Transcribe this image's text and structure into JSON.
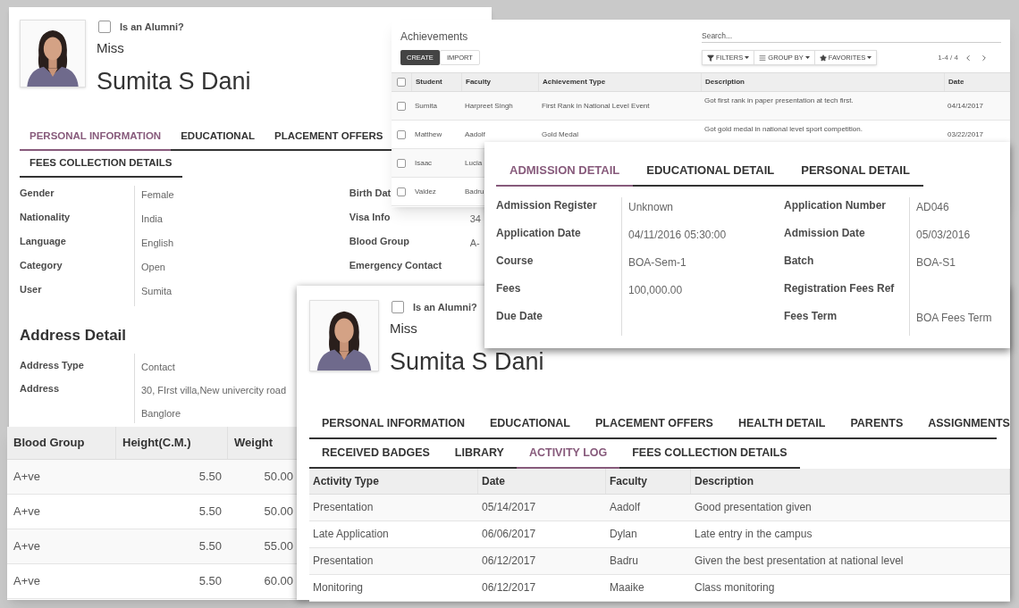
{
  "profile_back": {
    "alumni": {
      "label": "Is an Alumni?",
      "checked": false
    },
    "title": "Miss",
    "name": "Sumita S Dani",
    "tab_rows": [
      [
        {
          "label": "PERSONAL INFORMATION",
          "selected": true
        },
        {
          "label": "EDUCATIONAL",
          "selected": false
        },
        {
          "label": "PLACEMENT OFFERS",
          "selected": false
        }
      ],
      [
        {
          "label": "FEES COLLECTION DETAILS",
          "selected": false
        }
      ]
    ],
    "fields_left": [
      {
        "label": "Gender",
        "value": "Female"
      },
      {
        "label": "Nationality",
        "value": "India"
      },
      {
        "label": "Language",
        "value": "English"
      },
      {
        "label": "Category",
        "value": "Open"
      },
      {
        "label": "User",
        "value": "Sumita"
      }
    ],
    "fields_right": [
      {
        "label": "Birth Dat"
      },
      {
        "label": "Visa Info",
        "value": "34"
      },
      {
        "label": "Blood Group",
        "value": "A-"
      },
      {
        "label": "Emergency Contact"
      }
    ],
    "address_heading": "Address Detail",
    "address_fields": [
      {
        "label": "Address Type",
        "values": [
          "Contact"
        ]
      },
      {
        "label": "Address",
        "values": [
          "30, FIrst villa,New univercity road",
          "Banglore"
        ]
      }
    ]
  },
  "achievements": {
    "title": "Achievements",
    "search_placeholder": "Search...",
    "buttons": [
      {
        "label": "CREATE",
        "kind": "primary"
      },
      {
        "label": "IMPORT",
        "kind": "secondary"
      }
    ],
    "filters": [
      {
        "label": "FILTERS",
        "kind": "filter"
      },
      {
        "label": "GROUP BY",
        "kind": "group"
      },
      {
        "label": "FAVORITES",
        "kind": "favorite"
      }
    ],
    "pager": "1-4 / 4",
    "select_all_checked": false,
    "columns": [
      "Student",
      "Faculty",
      "Achievement Type",
      "Description",
      "Date"
    ],
    "rows": [
      {
        "checked": false,
        "cells": [
          "Sumita",
          "Harpreet Singh",
          "First Rank in National Level Event",
          "Got first rank in paper presentation at tech first.",
          "04/14/2017"
        ]
      },
      {
        "checked": false,
        "cells": [
          "Matthew",
          "Aadolf",
          "Gold Medal",
          "Got gold medal in national level sport competition.",
          "03/22/2017"
        ]
      },
      {
        "checked": false,
        "cells": [
          "Isaac",
          "Lucia"
        ]
      },
      {
        "checked": false,
        "cells": [
          "Valdez",
          "Badru"
        ]
      }
    ]
  },
  "admission": {
    "tabs": [
      {
        "label": "ADMISSION DETAIL",
        "selected": true
      },
      {
        "label": "EDUCATIONAL DETAIL",
        "selected": false
      },
      {
        "label": "PERSONAL DETAIL",
        "selected": false
      }
    ],
    "fields_left": [
      {
        "label": "Admission Register",
        "value": "Unknown"
      },
      {
        "label": "Application Date",
        "value": "04/11/2016 05:30:00"
      },
      {
        "label": "Course",
        "value": "BOA-Sem-1"
      },
      {
        "label": "Fees",
        "value": "100,000.00"
      },
      {
        "label": "Due Date"
      }
    ],
    "fields_right": [
      {
        "label": "Application Number",
        "value": "AD046"
      },
      {
        "label": "Admission Date",
        "value": "05/03/2016"
      },
      {
        "label": "Batch",
        "value": "BOA-S1"
      },
      {
        "label": "Registration Fees Ref"
      },
      {
        "label": "Fees Term",
        "value": "BOA Fees Term"
      }
    ]
  },
  "health_table": {
    "columns": [
      "Blood Group",
      "Height(C.M.)",
      "Weight"
    ],
    "rows": [
      [
        "A+ve",
        "5.50",
        "50.00"
      ],
      [
        "A+ve",
        "5.50",
        "50.00"
      ],
      [
        "A+ve",
        "5.50",
        "55.00"
      ],
      [
        "A+ve",
        "5.50",
        "60.00"
      ]
    ]
  },
  "profile_front": {
    "alumni": {
      "label": "Is an Alumni?",
      "checked": false
    },
    "title": "Miss",
    "name": "Sumita S Dani",
    "tab_rows": [
      [
        {
          "label": "PERSONAL INFORMATION",
          "selected": false
        },
        {
          "label": "EDUCATIONAL",
          "selected": false
        },
        {
          "label": "PLACEMENT OFFERS",
          "selected": false
        },
        {
          "label": "HEALTH DETAIL",
          "selected": false
        },
        {
          "label": "PARENTS",
          "selected": false
        },
        {
          "label": "ASSIGNMENTS",
          "selected": false
        }
      ],
      [
        {
          "label": "RECEIVED BADGES",
          "selected": false
        },
        {
          "label": "LIBRARY",
          "selected": false
        },
        {
          "label": "ACTIVITY LOG",
          "selected": true
        },
        {
          "label": "FEES COLLECTION DETAILS",
          "selected": false
        }
      ]
    ],
    "activity_table": {
      "columns": [
        "Activity Type",
        "Date",
        "Faculty",
        "Description"
      ],
      "rows": [
        [
          "Presentation",
          "05/14/2017",
          "Aadolf",
          "Good presentation given"
        ],
        [
          "Late Application",
          "06/06/2017",
          "Dylan",
          "Late entry in the campus"
        ],
        [
          "Presentation",
          "06/12/2017",
          "Badru",
          "Given the best presentation at national level"
        ],
        [
          "Monitoring",
          "06/12/2017",
          "Maaike",
          "Class monitoring"
        ]
      ]
    }
  }
}
